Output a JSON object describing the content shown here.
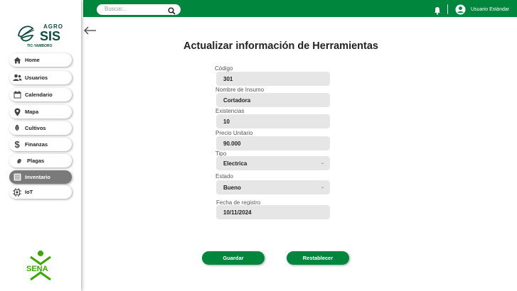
{
  "header": {
    "search_placeholder": "Buscar...",
    "username": "Usuario Estándar"
  },
  "logo": {
    "line1": "AGRO",
    "line2": "SIS",
    "line3": "TIC-YAMBORO"
  },
  "sidebar": {
    "items": [
      {
        "label": "Home",
        "icon": "home-icon"
      },
      {
        "label": "Usuarios",
        "icon": "users-icon"
      },
      {
        "label": "Calendario",
        "icon": "calendar-icon"
      },
      {
        "label": "Mapa",
        "icon": "map-pin-icon"
      },
      {
        "label": "Cultivos",
        "icon": "leaf-icon"
      },
      {
        "label": "Finanzas",
        "icon": "dollar-icon"
      },
      {
        "label": "Plagas",
        "icon": "bug-icon"
      },
      {
        "label": "Inventario",
        "icon": "inventory-icon"
      },
      {
        "label": "IoT",
        "icon": "chip-icon"
      }
    ],
    "active_index": 7
  },
  "sena_label": "SENA",
  "form": {
    "title": "Actualizar información de Herramientas",
    "fields": [
      {
        "label": "Código",
        "value": "301"
      },
      {
        "label": "Nombre de Insumo",
        "value": "Cortadora"
      },
      {
        "label": "Existencias",
        "value": "10"
      },
      {
        "label": "Precio Unitario",
        "value": "90.000"
      },
      {
        "label": "Tipo",
        "value": "Electrica"
      },
      {
        "label": "Estado",
        "value": "Bueno"
      },
      {
        "label": "Fecha  de registro",
        "value": "10/11/2024"
      }
    ],
    "save_label": "Guardar",
    "reset_label": "Restablecer"
  },
  "colors": {
    "primary": "#00873d",
    "active_nav": "#7a7a7a",
    "field_bg": "#e6e6e6"
  }
}
